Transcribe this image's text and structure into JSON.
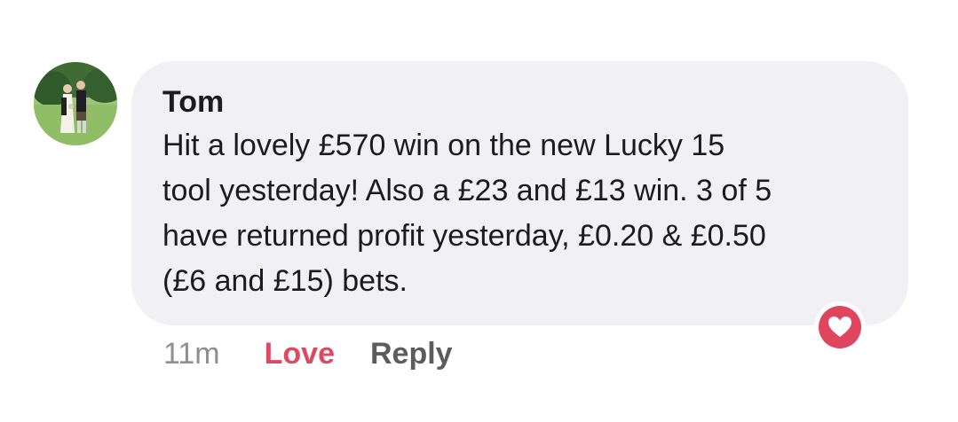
{
  "comment": {
    "author": "Tom",
    "text_lines": [
      "Hit a lovely £570 win on the new Lucky 15",
      "tool yesterday! Also a £23 and £13 win. 3 of 5",
      "have returned profit yesterday, £0.20 & £0.50",
      "(£6 and £15) bets."
    ],
    "timestamp": "11m",
    "actions": {
      "love_label": "Love",
      "reply_label": "Reply"
    },
    "reaction_icon": "heart-icon",
    "colors": {
      "bubble_background": "#f0f0f5",
      "love_accent": "#dd4960",
      "reaction_badge": "#e0455e",
      "timestamp_gray": "#8e8e93"
    }
  }
}
